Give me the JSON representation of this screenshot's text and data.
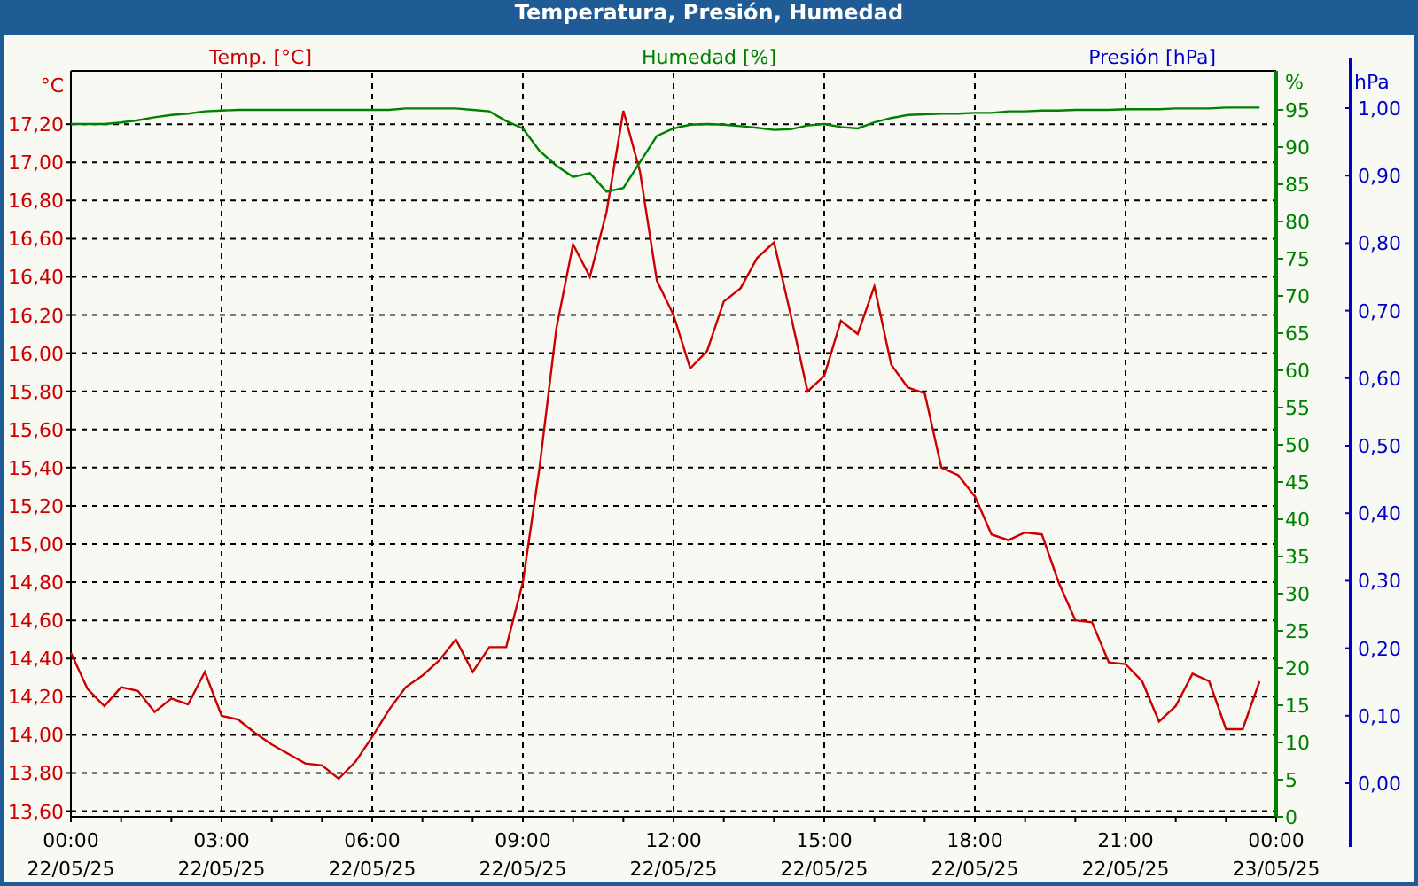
{
  "window": {
    "title": "Temperatura, Presión, Humedad"
  },
  "chart": {
    "chart_data": {
      "type": "line",
      "grid": true,
      "ylabel": "°C",
      "y2label": "%",
      "categories": [
        "00:00\n22/05/25",
        null,
        null,
        null,
        null,
        null,
        null,
        null,
        null,
        "03:00\n22/05/25",
        null,
        null,
        null,
        null,
        null,
        null,
        null,
        null,
        "06:00\n22/05/25",
        null,
        null,
        null,
        null,
        null,
        null,
        null,
        null,
        "09:00\n22/05/25",
        null,
        null,
        null,
        null,
        null,
        null,
        null,
        null,
        "12:00\n22/05/25",
        null,
        null,
        null,
        null,
        null,
        null,
        null,
        null,
        "15:00\n22/05/25",
        null,
        null,
        null,
        null,
        null,
        null,
        null,
        null,
        "18:00\n22/05/25",
        null,
        null,
        null,
        null,
        null,
        null,
        null,
        null,
        "21:00\n22/05/25",
        null,
        null,
        null,
        null,
        null,
        null,
        null,
        null,
        "00:00\n23/05/25"
      ],
      "ylim": [
        13.57,
        17.47
      ],
      "yticks": [
        {
          "value": 13.6,
          "label": "13,60"
        },
        {
          "value": 13.8,
          "label": "13,80"
        },
        {
          "value": 14.0,
          "label": "14,00"
        },
        {
          "value": 14.2,
          "label": "14,20"
        },
        {
          "value": 14.4,
          "label": "14,40"
        },
        {
          "value": 14.6,
          "label": "14,60"
        },
        {
          "value": 14.8,
          "label": "14,80"
        },
        {
          "value": 15.0,
          "label": "15,00"
        },
        {
          "value": 15.2,
          "label": "15,20"
        },
        {
          "value": 15.4,
          "label": "15,40"
        },
        {
          "value": 15.6,
          "label": "15,60"
        },
        {
          "value": 15.8,
          "label": "15,80"
        },
        {
          "value": 16.0,
          "label": "16,00"
        },
        {
          "value": 16.2,
          "label": "16,20"
        },
        {
          "value": 16.4,
          "label": "16,40"
        },
        {
          "value": 16.6,
          "label": "16,60"
        },
        {
          "value": 16.8,
          "label": "16,80"
        },
        {
          "value": 17.0,
          "label": "17,00"
        },
        {
          "value": 17.2,
          "label": "17,20"
        }
      ],
      "y2lim": [
        0,
        100
      ],
      "y2ticks": [
        0,
        5,
        10,
        15,
        20,
        25,
        30,
        35,
        40,
        45,
        50,
        55,
        60,
        65,
        70,
        75,
        80,
        85,
        90,
        95
      ],
      "series": [
        {
          "name": "Temp. [°C]",
          "color": "#cc0000",
          "axis": "y",
          "values": [
            14.43,
            14.24,
            14.15,
            14.25,
            14.23,
            14.12,
            14.19,
            14.16,
            14.33,
            14.1,
            14.08,
            14.01,
            13.95,
            13.9,
            13.85,
            13.84,
            13.77,
            13.86,
            13.99,
            14.13,
            14.25,
            14.31,
            14.39,
            14.5,
            14.33,
            14.46,
            14.46,
            14.8,
            15.4,
            16.13,
            16.57,
            16.4,
            16.74,
            17.27,
            16.95,
            16.38,
            16.2,
            15.92,
            16.01,
            16.27,
            16.34,
            16.5,
            16.58,
            16.2,
            15.8,
            15.88,
            16.17,
            16.1,
            16.35,
            15.94,
            15.82,
            15.79,
            15.4,
            15.36,
            15.25,
            15.05,
            15.02,
            15.06,
            15.05,
            14.8,
            14.6,
            14.59,
            14.38,
            14.37,
            14.28,
            14.07,
            14.15,
            14.32,
            14.28,
            14.03,
            14.03,
            14.28,
            null
          ]
        },
        {
          "name": "Humedad [%]",
          "color": "#008000",
          "axis": "y2",
          "values": [
            93.1,
            93.1,
            93.1,
            93.3,
            93.6,
            94.0,
            94.3,
            94.5,
            94.8,
            94.9,
            95.0,
            95.0,
            95.0,
            95.0,
            95.0,
            95.0,
            95.0,
            95.0,
            95.0,
            95.0,
            95.2,
            95.2,
            95.2,
            95.2,
            95.0,
            94.8,
            93.5,
            92.5,
            89.5,
            87.5,
            86.0,
            86.5,
            84.0,
            84.5,
            88.0,
            91.5,
            92.5,
            93.0,
            93.1,
            93.0,
            92.8,
            92.6,
            92.3,
            92.4,
            92.9,
            93.1,
            92.7,
            92.5,
            93.3,
            93.9,
            94.3,
            94.4,
            94.5,
            94.5,
            94.6,
            94.6,
            94.8,
            94.8,
            94.9,
            94.9,
            95.0,
            95.0,
            95.0,
            95.1,
            95.1,
            95.1,
            95.2,
            95.2,
            95.2,
            95.3,
            95.3,
            95.3,
            null
          ]
        }
      ]
    },
    "pressure_axis": {
      "legend": "Presión [hPa]",
      "color": "#0000cc",
      "unit": "hPa",
      "ticks": [
        "1,00",
        "0,90",
        "0,80",
        "0,70",
        "0,60",
        "0,50",
        "0,40",
        "0,30",
        "0,20",
        "0,10",
        "0,00"
      ]
    }
  }
}
